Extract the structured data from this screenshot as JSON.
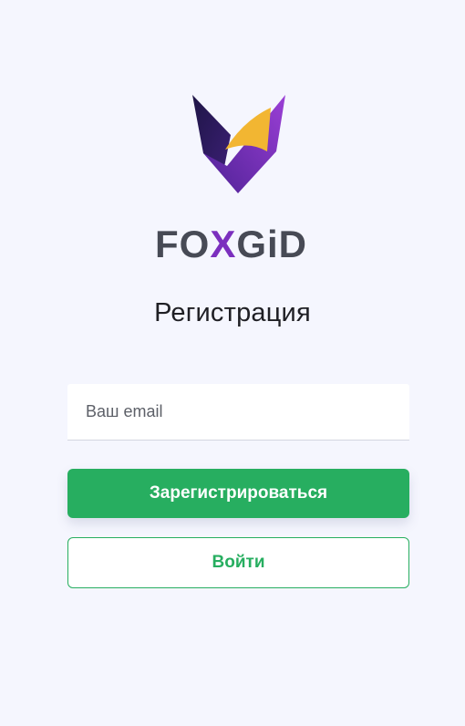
{
  "brand": {
    "name": "FOXGID",
    "wordmark_parts": [
      "FO",
      "X",
      "GiD"
    ],
    "colors": {
      "purple_dark": "#2a1a5e",
      "purple": "#7b2fbe",
      "yellow": "#f2b632",
      "wordmark_gray": "#474a55"
    }
  },
  "form": {
    "title": "Регистрация",
    "email_placeholder": "Ваш email",
    "email_value": "",
    "register_label": "Зарегистрироваться",
    "login_label": "Войти"
  },
  "colors": {
    "background": "#f5f6fe",
    "accent_green": "#27ae60"
  }
}
